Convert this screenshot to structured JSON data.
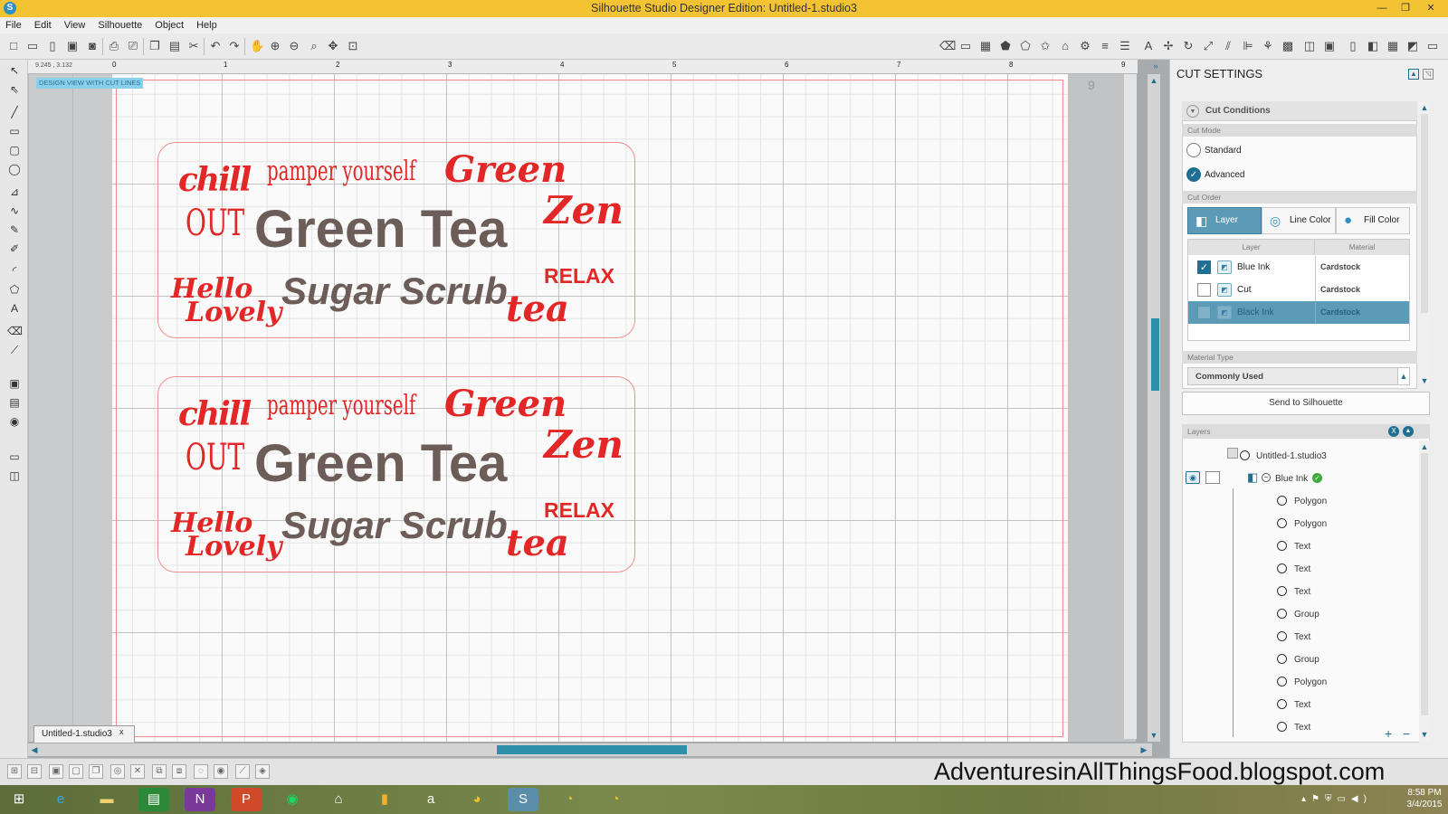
{
  "window": {
    "title": "Silhouette Studio Designer Edition: Untitled-1.studio3"
  },
  "menu": [
    "File",
    "Edit",
    "View",
    "Silhouette",
    "Object",
    "Help"
  ],
  "canvas": {
    "coords": "9.245 , 3.132",
    "view_label": "DESIGN VIEW WITH CUT LINES",
    "ruler_marks": [
      "0",
      "1",
      "2",
      "3",
      "4",
      "5",
      "6",
      "7",
      "8",
      "9"
    ],
    "page_number": "9",
    "doc_tab": "Untitled-1.studio3",
    "doc_tab_close": "x"
  },
  "labels": [
    {
      "chill": "chill",
      "out": "OUT",
      "pamper": "pamper yourself",
      "green_script": "Green",
      "zen": "Zen",
      "green_tea": "Green Tea",
      "relax": "RELAX",
      "hello": "Hello",
      "lovely": "Lovely",
      "sugar_scrub": "Sugar Scrub",
      "tea": "tea"
    },
    {
      "chill": "chill",
      "out": "OUT",
      "pamper": "pamper yourself",
      "green_script": "Green",
      "zen": "Zen",
      "green_tea": "Green Tea",
      "relax": "RELAX",
      "hello": "Hello",
      "lovely": "Lovely",
      "sugar_scrub": "Sugar Scrub",
      "tea": "tea"
    }
  ],
  "colors": {
    "design_red": "#e32626",
    "design_brown": "#6d5d58",
    "accent": "#1f6f92",
    "titlebar": "#f3c334"
  },
  "cut_settings": {
    "title": "CUT SETTINGS",
    "cut_conditions": "Cut Conditions",
    "cut_mode_label": "Cut Mode",
    "modes": [
      {
        "label": "Standard",
        "selected": false
      },
      {
        "label": "Advanced",
        "selected": true
      }
    ],
    "cut_order_label": "Cut Order",
    "order_buttons": [
      {
        "label": "Layer",
        "selected": true
      },
      {
        "label": "Line Color",
        "selected": false
      },
      {
        "label": "Fill Color",
        "selected": false
      }
    ],
    "table_headers": [
      "Layer",
      "Material"
    ],
    "layers": [
      {
        "name": "Blue Ink",
        "material": "Cardstock",
        "checked": true
      },
      {
        "name": "Cut",
        "material": "Cardstock",
        "checked": false
      },
      {
        "name": "Black Ink",
        "material": "Cardstock",
        "checked": false
      }
    ],
    "material_type_label": "Material Type",
    "material_type_value": "Commonly Used",
    "send_button": "Send to Silhouette"
  },
  "layers_panel": {
    "title": "Layers",
    "document": "Untitled-1.studio3",
    "layer": "Blue Ink",
    "items": [
      "Polygon",
      "Polygon",
      "Text",
      "Text",
      "Text",
      "Group",
      "Text",
      "Group",
      "Polygon",
      "Text",
      "Text"
    ],
    "add_label": "+",
    "remove_label": "−"
  },
  "watermark": "AdventuresinAllThingsFood.blogspot.com",
  "taskbar": {
    "time": "8:58 PM",
    "date": "3/4/2015"
  }
}
